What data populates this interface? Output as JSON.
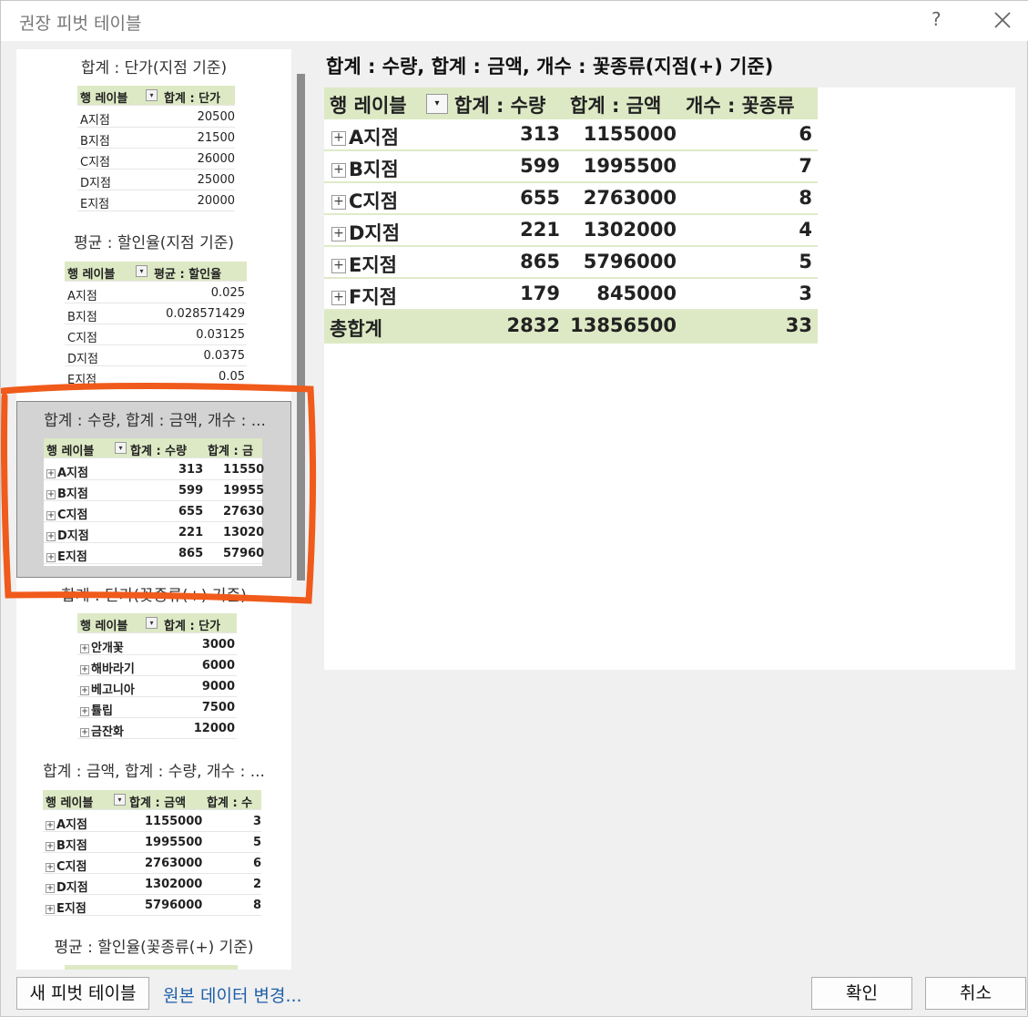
{
  "dialog": {
    "title": "권장 피벗 테이블",
    "help": "?",
    "new_pivot_button": "새 피벗 테이블",
    "change_source_link": "원본 데이터 변경...",
    "ok_button": "확인",
    "cancel_button": "취소"
  },
  "recommendations": [
    {
      "title": "합계 : 단가(지점 기준)",
      "header": [
        "행 레이블",
        "합계 : 단가"
      ],
      "rows": [
        [
          "A지점",
          "20500"
        ],
        [
          "B지점",
          "21500"
        ],
        [
          "C지점",
          "26000"
        ],
        [
          "D지점",
          "25000"
        ],
        [
          "E지점",
          "20000"
        ]
      ]
    },
    {
      "title": "평균 : 할인율(지점 기준)",
      "header": [
        "행 레이블",
        "평균 : 할인율"
      ],
      "rows": [
        [
          "A지점",
          "0.025"
        ],
        [
          "B지점",
          "0.028571429"
        ],
        [
          "C지점",
          "0.03125"
        ],
        [
          "D지점",
          "0.0375"
        ],
        [
          "E지점",
          "0.05"
        ]
      ]
    },
    {
      "title": "합계 : 수량, 합계 : 금액, 개수 : ...",
      "header": [
        "행 레이블",
        "합계 : 수량",
        "합계 : 금"
      ],
      "rows": [
        [
          "A지점",
          "313",
          "11550"
        ],
        [
          "B지점",
          "599",
          "19955"
        ],
        [
          "C지점",
          "655",
          "27630"
        ],
        [
          "D지점",
          "221",
          "13020"
        ],
        [
          "E지점",
          "865",
          "57960"
        ]
      ],
      "selected": true
    },
    {
      "title": "합계 : 단가(꽃종류(+) 기준)",
      "header": [
        "행 레이블",
        "합계 : 단가"
      ],
      "rows": [
        [
          "안개꽃",
          "3000"
        ],
        [
          "해바라기",
          "6000"
        ],
        [
          "베고니아",
          "9000"
        ],
        [
          "튤립",
          "7500"
        ],
        [
          "금잔화",
          "12000"
        ]
      ]
    },
    {
      "title": "합계 : 금액, 합계 : 수량, 개수 : ...",
      "header": [
        "행 레이블",
        "합계 : 금액",
        "합계 : 수"
      ],
      "rows": [
        [
          "A지점",
          "1155000",
          "3"
        ],
        [
          "B지점",
          "1995500",
          "5"
        ],
        [
          "C지점",
          "2763000",
          "6"
        ],
        [
          "D지점",
          "1302000",
          "2"
        ],
        [
          "E지점",
          "5796000",
          "8"
        ]
      ]
    },
    {
      "title": "평균 : 할인율(꽃종류(+) 기준)"
    }
  ],
  "preview": {
    "title": "합계 : 수량, 합계 : 금액, 개수 : 꽃종류(지점(+) 기준)",
    "header": [
      "행 레이블",
      "합계 : 수량",
      "합계 : 금액",
      "개수 : 꽃종류"
    ],
    "rows": [
      [
        "A지점",
        "313",
        "1155000",
        "6"
      ],
      [
        "B지점",
        "599",
        "1995500",
        "7"
      ],
      [
        "C지점",
        "655",
        "2763000",
        "8"
      ],
      [
        "D지점",
        "221",
        "1302000",
        "4"
      ],
      [
        "E지점",
        "865",
        "5796000",
        "5"
      ],
      [
        "F지점",
        "179",
        "845000",
        "3"
      ]
    ],
    "total": [
      "총합계",
      "2832",
      "13856500",
      "33"
    ]
  },
  "colors": {
    "header_fill": "#dde9c4",
    "annotation": "#f05a1a",
    "link": "#1e5fa8"
  }
}
